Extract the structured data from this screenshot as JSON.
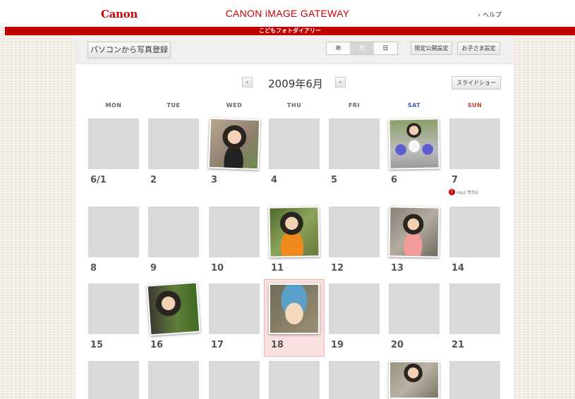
{
  "header": {
    "logo": "Canon",
    "brand": "CANON iMAGE GATEWAY",
    "help_link": "› ヘルプ",
    "subtitle": "こどもフォトダイアリー"
  },
  "toolbar": {
    "upload_button": "パソコンから写真登録",
    "view_year": "年",
    "view_month": "月",
    "view_day": "日",
    "active_view": "月",
    "public_settings": "限定公開設定",
    "child_settings": "お子さま設定"
  },
  "calendar": {
    "prev_label": "‹",
    "next_label": "›",
    "title": "2009年6月",
    "slideshow_button": "スライドショー",
    "weekdays": [
      "MON",
      "TUE",
      "WED",
      "THU",
      "FRI",
      "SAT",
      "SUN"
    ],
    "week1": [
      "6/1",
      "2",
      "3",
      "4",
      "5",
      "6",
      "7"
    ],
    "week2": [
      "8",
      "9",
      "10",
      "11",
      "12",
      "13",
      "14"
    ],
    "week3": [
      "15",
      "16",
      "17",
      "18",
      "19",
      "20",
      "21"
    ],
    "note": {
      "icon_label": "!",
      "text": "rep2 性別2"
    }
  },
  "colors": {
    "brand_red": "#cc0000",
    "saturday": "#3b5fa8",
    "sunday": "#c0392b",
    "today_bg": "#fbe0e0"
  }
}
